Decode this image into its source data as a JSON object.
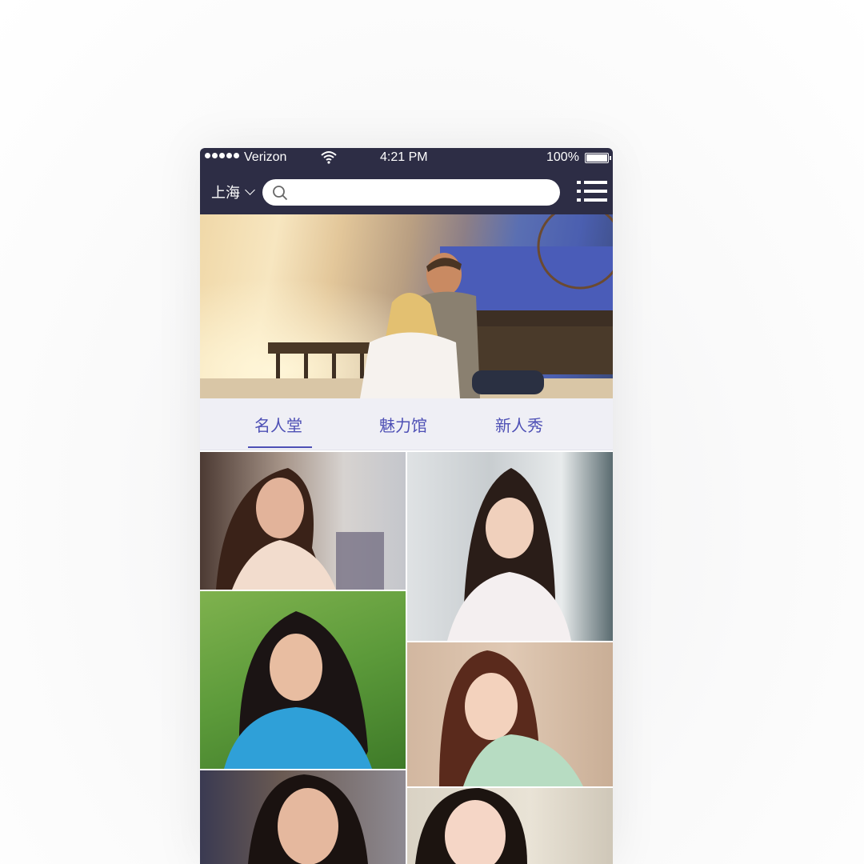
{
  "status_bar": {
    "carrier": "Verizon",
    "time": "4:21  PM",
    "battery": "100%"
  },
  "header": {
    "city": "上海",
    "search_placeholder": ""
  },
  "tabs": [
    {
      "label": "名人堂",
      "active": true
    },
    {
      "label": "魅力馆",
      "active": false
    },
    {
      "label": "新人秀",
      "active": false
    }
  ],
  "colors": {
    "header_bg": "#2d2d45",
    "tab_accent": "#4d4fb5",
    "tab_bg": "#efeff5"
  },
  "icons": [
    "signal-dots-icon",
    "wifi-icon",
    "battery-icon",
    "chevron-down-icon",
    "search-icon",
    "list-menu-icon"
  ]
}
